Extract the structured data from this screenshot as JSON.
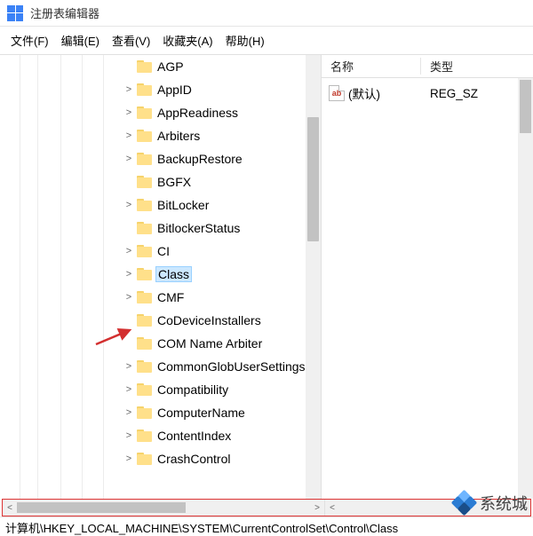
{
  "title": "注册表编辑器",
  "menu": {
    "file": "文件(F)",
    "edit": "编辑(E)",
    "view": "查看(V)",
    "favorites": "收藏夹(A)",
    "help": "帮助(H)"
  },
  "tree": {
    "items": [
      {
        "label": "AGP",
        "expander": ""
      },
      {
        "label": "AppID",
        "expander": ">"
      },
      {
        "label": "AppReadiness",
        "expander": ">"
      },
      {
        "label": "Arbiters",
        "expander": ">"
      },
      {
        "label": "BackupRestore",
        "expander": ">"
      },
      {
        "label": "BGFX",
        "expander": ""
      },
      {
        "label": "BitLocker",
        "expander": ">"
      },
      {
        "label": "BitlockerStatus",
        "expander": ""
      },
      {
        "label": "CI",
        "expander": ">"
      },
      {
        "label": "Class",
        "expander": ">",
        "selected": true
      },
      {
        "label": "CMF",
        "expander": ">"
      },
      {
        "label": "CoDeviceInstallers",
        "expander": ""
      },
      {
        "label": "COM Name Arbiter",
        "expander": ""
      },
      {
        "label": "CommonGlobUserSettings",
        "expander": ">"
      },
      {
        "label": "Compatibility",
        "expander": ">"
      },
      {
        "label": "ComputerName",
        "expander": ">"
      },
      {
        "label": "ContentIndex",
        "expander": ">"
      },
      {
        "label": "CrashControl",
        "expander": ">"
      }
    ]
  },
  "list": {
    "header_name": "名称",
    "header_type": "类型",
    "rows": [
      {
        "icon": "ab",
        "name": "(默认)",
        "type": "REG_SZ"
      }
    ]
  },
  "statusbar": "计算机\\HKEY_LOCAL_MACHINE\\SYSTEM\\CurrentControlSet\\Control\\Class",
  "watermark": "系统城"
}
